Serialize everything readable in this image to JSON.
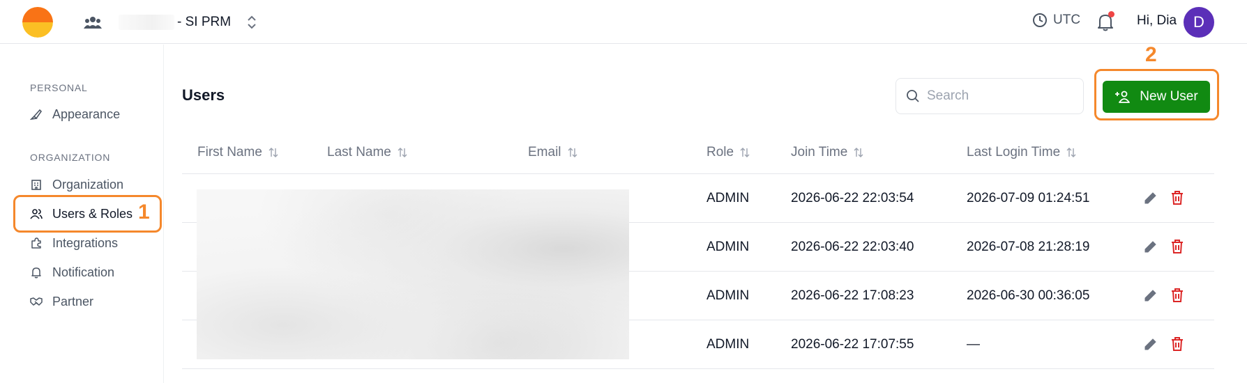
{
  "header": {
    "org_name": "- SI PRM",
    "timezone": "UTC",
    "greeting": "Hi, Dia",
    "avatar_initial": "D",
    "notification_dot": true
  },
  "sidebar": {
    "sections": [
      {
        "label": "PERSONAL",
        "items": [
          {
            "label": "Appearance",
            "icon": "paintbrush-icon"
          }
        ]
      },
      {
        "label": "ORGANIZATION",
        "items": [
          {
            "label": "Organization",
            "icon": "building-icon"
          },
          {
            "label": "Users & Roles",
            "icon": "users-icon",
            "active": true
          },
          {
            "label": "Integrations",
            "icon": "puzzle-icon"
          },
          {
            "label": "Notification",
            "icon": "bell-icon"
          },
          {
            "label": "Partner",
            "icon": "handshake-icon"
          }
        ]
      }
    ]
  },
  "annotations": {
    "marker_1": "1",
    "marker_2": "2",
    "color": "#f5882c"
  },
  "main": {
    "title": "Users",
    "search_placeholder": "Search",
    "new_user_label": "New User",
    "columns": [
      "First Name",
      "Last Name",
      "Email",
      "Role",
      "Join Time",
      "Last Login Time"
    ],
    "rows": [
      {
        "role": "ADMIN",
        "join_time": "2026-06-22 22:03:54",
        "last_login": "2026-07-09 01:24:51"
      },
      {
        "role": "ADMIN",
        "join_time": "2026-06-22 22:03:40",
        "last_login": "2026-07-08 21:28:19"
      },
      {
        "role": "ADMIN",
        "join_time": "2026-06-22 17:08:23",
        "last_login": "2026-06-30 00:36:05"
      },
      {
        "role": "ADMIN",
        "join_time": "2026-06-22 17:07:55",
        "last_login": "—"
      }
    ]
  },
  "colors": {
    "primary_button": "#118a12",
    "delete_icon": "#dc2626",
    "avatar": "#5b2fb8",
    "highlight": "#f5882c"
  }
}
